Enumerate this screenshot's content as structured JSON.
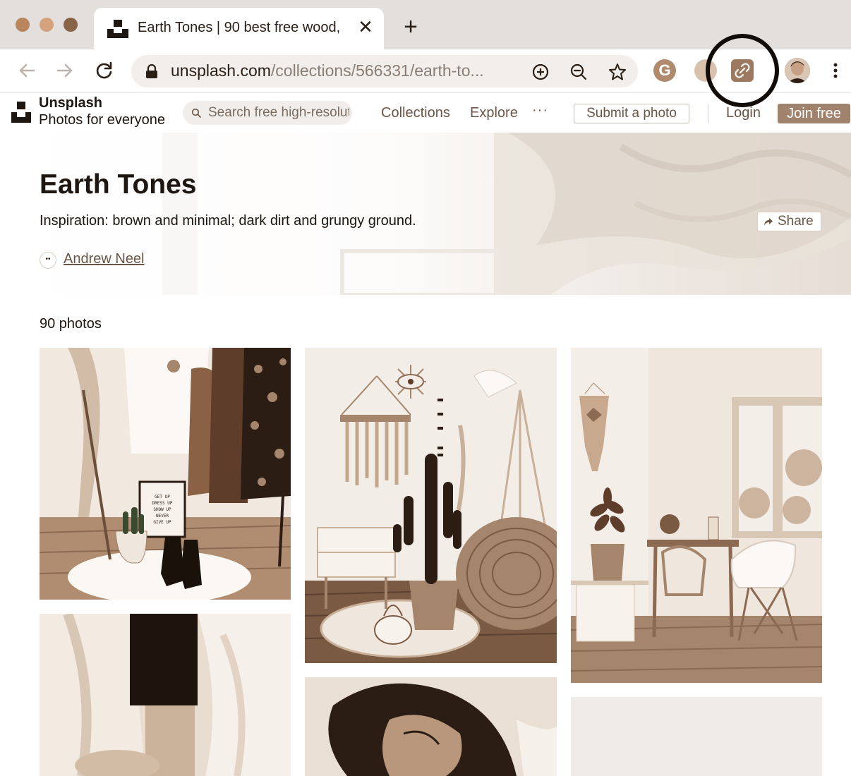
{
  "browser": {
    "tab": {
      "title": "Earth Tones | 90 best free wood,",
      "close_icon": "close-icon"
    },
    "new_tab_icon": "plus-icon",
    "url": {
      "host": "unsplash.com",
      "path": "/collections/566331/earth-to..."
    },
    "toolbar_icons": [
      "back-icon",
      "forward-icon",
      "reload-icon",
      "lock-icon",
      "add-icon",
      "zoom-out-icon",
      "bookmark-star-icon",
      "grammarly-icon",
      "extension-icon",
      "link-icon",
      "profile-avatar",
      "menu-icon"
    ],
    "grammarly_label": "G"
  },
  "site": {
    "brand": {
      "name": "Unsplash",
      "tagline": "Photos for everyone"
    },
    "search": {
      "placeholder": "Search free high-resolution photos"
    },
    "nav": {
      "collections": "Collections",
      "explore": "Explore",
      "more": "···"
    },
    "submit_label": "Submit a photo",
    "login_label": "Login",
    "join_label": "Join free"
  },
  "collection": {
    "title": "Earth Tones",
    "description": "Inspiration: brown and minimal; dark dirt and grungy ground.",
    "curator_initials": "••",
    "curator": "Andrew Neel",
    "share_label": "Share",
    "photo_count": "90 photos"
  },
  "photos": [
    {
      "name": "clothing-rack-photo",
      "poster_lines": [
        "GET UP",
        "DRESS UP",
        "SHOW UP",
        "NEVER",
        "GIVE UP"
      ]
    },
    {
      "name": "cactus-room-photo"
    },
    {
      "name": "dining-room-photo"
    },
    {
      "name": "beige-blazer-photo"
    },
    {
      "name": "sleeping-person-photo"
    },
    {
      "name": "placeholder-photo"
    }
  ],
  "colors": {
    "accent": "#a1836d",
    "text_dark": "#1e1610",
    "text_muted": "#6a5647",
    "sepia_dark": "#2b1d13",
    "sepia_mid": "#a5856c",
    "sepia_light": "#efe6dd"
  }
}
